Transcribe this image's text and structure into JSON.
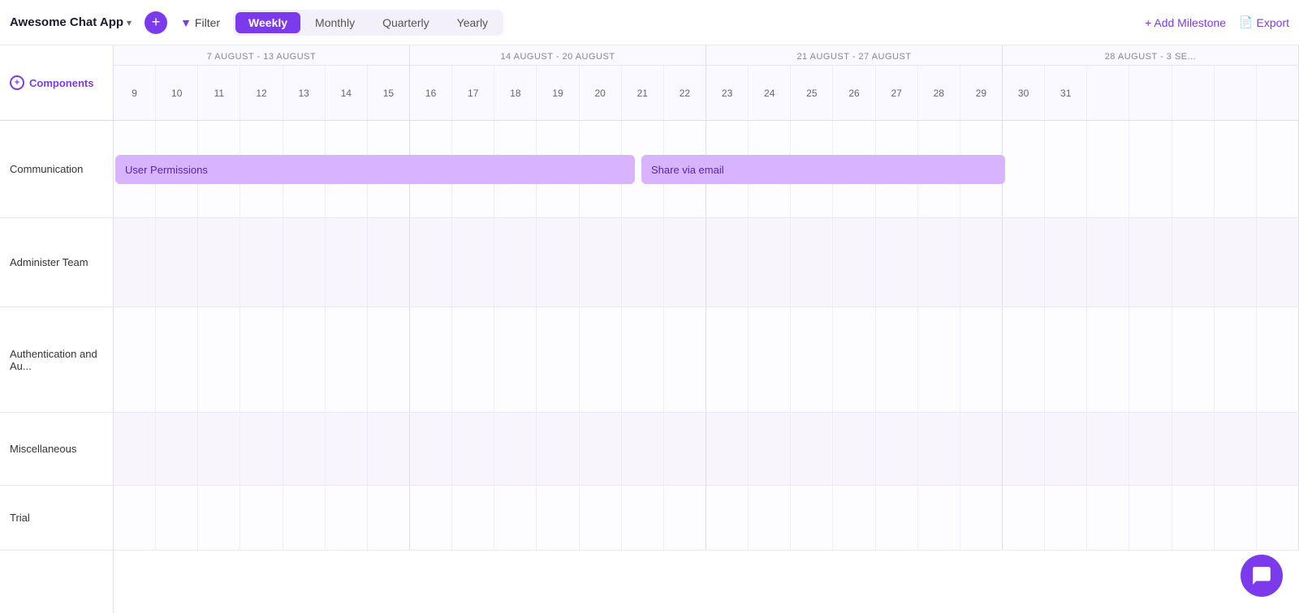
{
  "toolbar": {
    "app_name": "Awesome Chat App",
    "add_button_label": "+",
    "filter_label": "Filter",
    "views": [
      {
        "id": "weekly",
        "label": "Weekly",
        "active": true
      },
      {
        "id": "monthly",
        "label": "Monthly",
        "active": false
      },
      {
        "id": "quarterly",
        "label": "Quarterly",
        "active": false
      },
      {
        "id": "yearly",
        "label": "Yearly",
        "active": false
      }
    ],
    "add_milestone_label": "+ Add Milestone",
    "export_label": "Export"
  },
  "gantt": {
    "components_label": "Components",
    "weeks": [
      {
        "label": "7 AUGUST - 13 AUGUST",
        "days": [
          "9",
          "10",
          "11",
          "12",
          "13",
          "14",
          "15"
        ]
      },
      {
        "label": "14 AUGUST - 20 AUGUST",
        "days": [
          "16",
          "17",
          "18",
          "19",
          "20",
          "21",
          "22"
        ]
      },
      {
        "label": "21 AUGUST - 27 AUGUST",
        "days": [
          "23",
          "24",
          "25",
          "26",
          "27",
          "28",
          "29"
        ]
      },
      {
        "label": "28 AUGUST - 3 SE...",
        "days": [
          "30",
          "31",
          "",
          "",
          "",
          "",
          ""
        ]
      }
    ],
    "rows": [
      {
        "id": "communication",
        "label": "Communication",
        "height": "h120"
      },
      {
        "id": "administer-team",
        "label": "Administer Team",
        "height": "h110"
      },
      {
        "id": "authentication",
        "label": "Authentication and Au...",
        "height": "h130"
      },
      {
        "id": "miscellaneous",
        "label": "Miscellaneous",
        "height": "h90"
      },
      {
        "id": "trial",
        "label": "Trial",
        "height": "h80"
      }
    ],
    "tasks": [
      {
        "id": "user-permissions",
        "label": "User Permissions",
        "row": 0,
        "start_week": 0,
        "start_day": 0,
        "span_days": 6
      },
      {
        "id": "share-via-email",
        "label": "Share via email",
        "row": 0,
        "start_week": 1,
        "start_day": 0,
        "span_days": 6
      }
    ]
  }
}
